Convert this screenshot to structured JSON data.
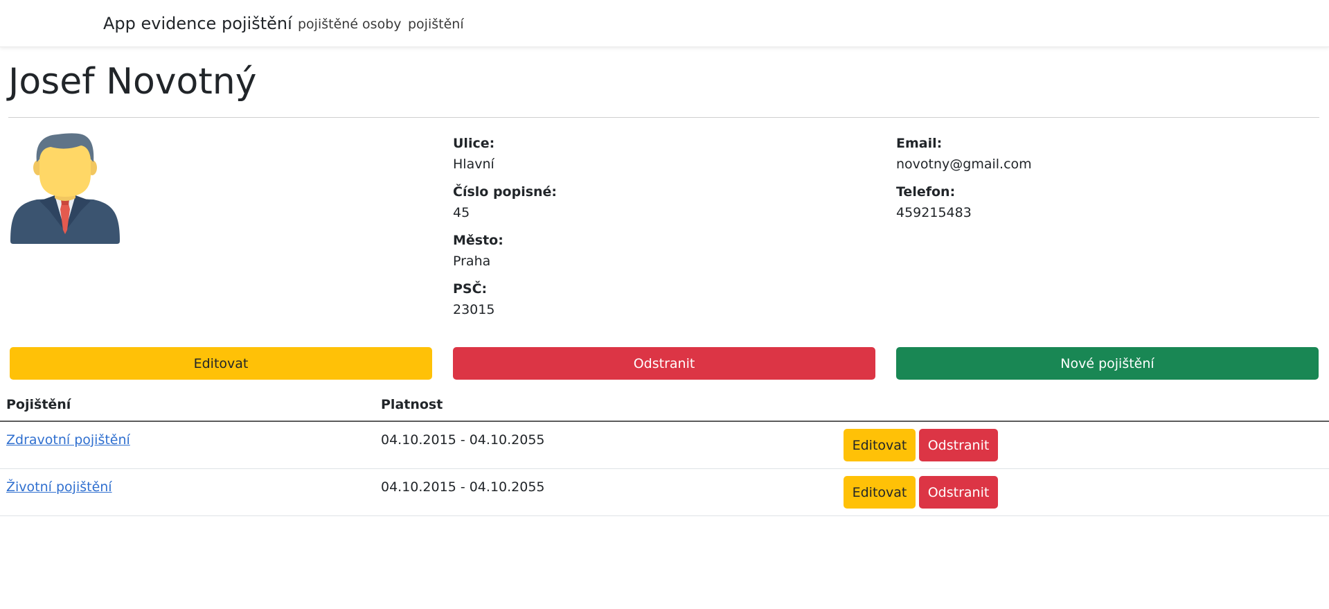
{
  "navbar": {
    "brand": "App evidence pojištění",
    "links": [
      {
        "label": "pojištěné osoby"
      },
      {
        "label": "pojištění"
      }
    ]
  },
  "person": {
    "name": "Josef Novotný",
    "address": [
      {
        "label": "Ulice:",
        "value": "Hlavní"
      },
      {
        "label": "Číslo popisné:",
        "value": "45"
      },
      {
        "label": "Město:",
        "value": "Praha"
      },
      {
        "label": "PSČ:",
        "value": "23015"
      }
    ],
    "contact": [
      {
        "label": "Email:",
        "value": "novotny@gmail.com"
      },
      {
        "label": "Telefon:",
        "value": "459215483"
      }
    ]
  },
  "actions": {
    "edit": "Editovat",
    "delete": "Odstranit",
    "new_insurance": "Nové pojištění"
  },
  "table": {
    "headers": [
      "Pojištění",
      "Platnost"
    ],
    "rows": [
      {
        "name": "Zdravotní pojištění",
        "validity": "04.10.2015 - 04.10.2055",
        "edit": "Editovat",
        "delete": "Odstranit"
      },
      {
        "name": "Životní pojištění",
        "validity": "04.10.2015 - 04.10.2055",
        "edit": "Editovat",
        "delete": "Odstranit"
      }
    ]
  },
  "colors": {
    "warning": "#ffc107",
    "danger": "#dc3545",
    "success": "#198754",
    "link": "#2f6fcf"
  },
  "icons": {
    "avatar": "businessman-avatar-icon"
  }
}
